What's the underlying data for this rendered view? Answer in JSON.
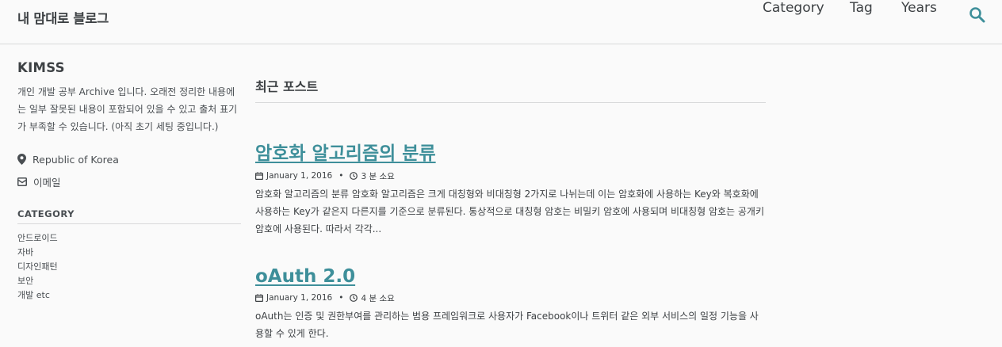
{
  "masthead": {
    "site_title": "내 맘대로 블로그",
    "nav": {
      "category": "Category",
      "tag": "Tag",
      "years": "Years"
    },
    "search_icon": "search-icon"
  },
  "sidebar": {
    "author_name": "KIMSS",
    "bio": "개인 개발 공부 Archive 입니다. 오래전 정리한 내용에는 일부 잘못된 내용이 포함되어 있을 수 있고 출처 표기가 부족할 수 있습니다. (아직 초기 세팅 중입니다.)",
    "location": "Republic of Korea",
    "email_label": "이메일",
    "category_heading": "CATEGORY",
    "categories": [
      "안드로이드",
      "자바",
      "디자인패턴",
      "보안",
      "개발 etc"
    ]
  },
  "main": {
    "archive_title": "최근 포스트",
    "posts": [
      {
        "title": "암호화 알고리즘의 분류",
        "date": "January 1, 2016",
        "read_time": "3 분 소요",
        "excerpt": "암호화 알고리즘의 분류 암호화 알고리즘은 크게 대칭형와 비대칭형 2가지로 나뉘는데 이는 암호화에 사용하는 Key와 복호화에 사용하는 Key가 같은지 다른지를 기준으로 분류된다. 통상적으로 대칭형 암호는 비밀키 암호에 사용되며 비대칭형 암호는 공개키 암호에 사용된다. 따라서 각각..."
      },
      {
        "title": "oAuth 2.0",
        "date": "January 1, 2016",
        "read_time": "4 분 소요",
        "excerpt": "oAuth는 인증 및 권한부여를 관리하는 범용 프레임워크로 사용자가 Facebook이나 트위터 같은 외부 서비스의 일정 기능을 사용할 수 있게 한다."
      }
    ]
  },
  "colors": {
    "link": "#3e8f9a",
    "text": "#3d4144",
    "border": "#d8d9da",
    "background": "#fafafa"
  }
}
